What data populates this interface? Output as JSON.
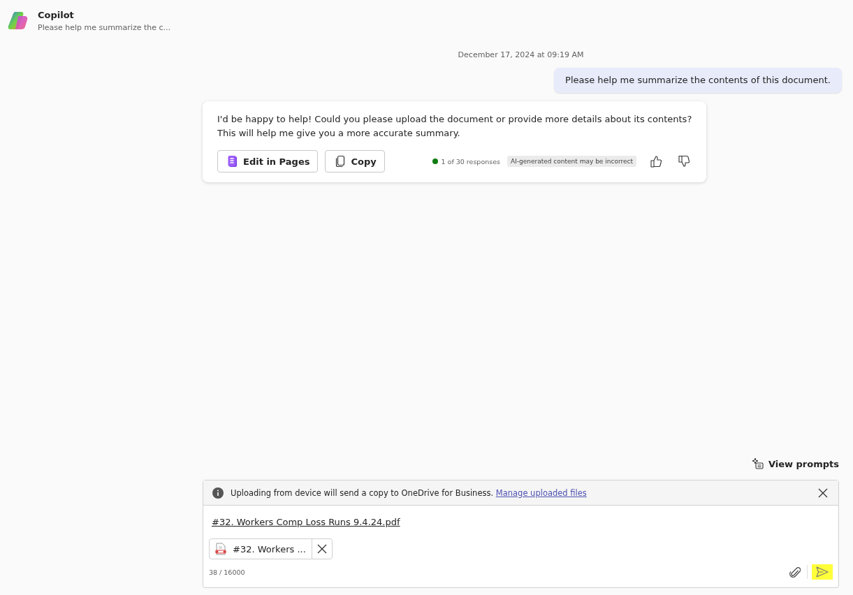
{
  "header": {
    "title": "Copilot",
    "subtitle": "Please help me summarize the c..."
  },
  "conversation": {
    "timestamp": "December 17, 2024 at 09:19 AM",
    "messages": [
      {
        "kind": "user",
        "text": "Please help me summarize the contents of this document."
      },
      {
        "kind": "assistant",
        "text": "I'd be happy to help! Could you please upload the document or provide more details about its contents? This will help me give you a more accurate summary.",
        "actions": [
          {
            "kind": "pages",
            "label": "Edit in Pages"
          },
          {
            "kind": "copy",
            "label": "Copy"
          }
        ],
        "response_count": "1 of 30 responses",
        "disclaimer": "AI-generated content may be incorrect"
      }
    ]
  },
  "view_prompts": "View prompts",
  "notice": {
    "text": "Uploading from device will send a copy to OneDrive for Business.",
    "link": "Manage uploaded files"
  },
  "composer": {
    "value": "#32. Workers Comp Loss Runs 9.4.24.pdf",
    "attachment": {
      "name": "#32. Workers ..."
    },
    "char_count": "38 / 16000",
    "send_highlighted": true
  }
}
